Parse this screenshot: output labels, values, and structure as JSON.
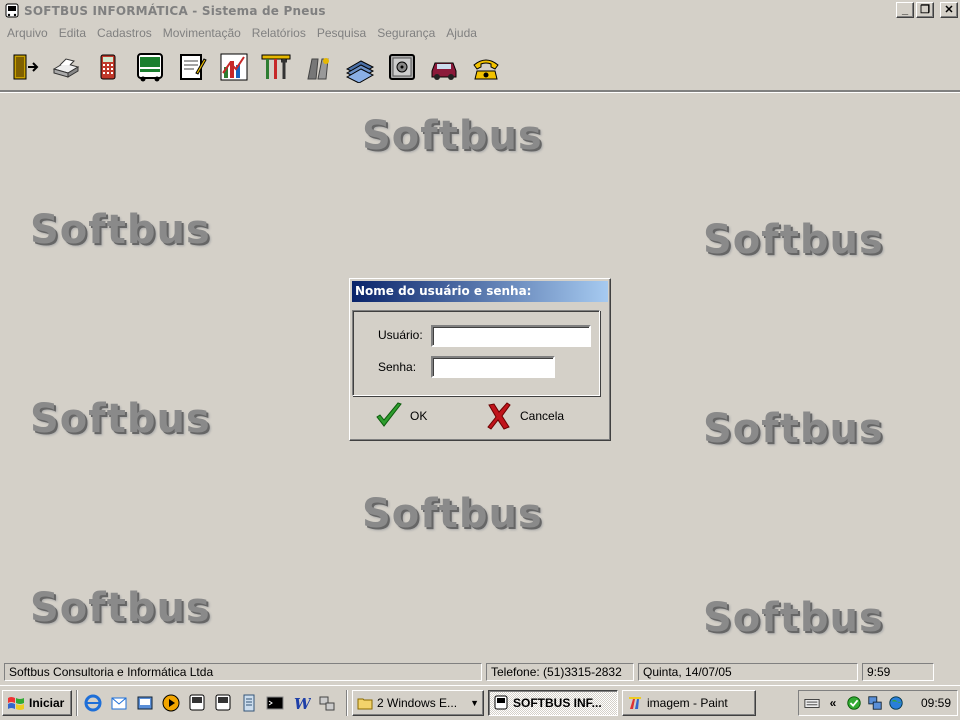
{
  "window": {
    "title": "SOFTBUS INFORMÁTICA - Sistema de Pneus",
    "minimize_glyph": "_",
    "restore_glyph": "❐",
    "close_glyph": "✕"
  },
  "menu": [
    {
      "label": "Arquivo"
    },
    {
      "label": "Edita"
    },
    {
      "label": "Cadastros"
    },
    {
      "label": "Movimentação"
    },
    {
      "label": "Relatórios"
    },
    {
      "label": "Pesquisa"
    },
    {
      "label": "Segurança"
    },
    {
      "label": "Ajuda"
    }
  ],
  "toolbar": {
    "icons": [
      "exit-door-icon",
      "printer-icon",
      "calculator-icon",
      "bus-icon",
      "notepad-icon",
      "chart-icon",
      "tools-icon",
      "tire-icon",
      "money-stack-icon",
      "safe-icon",
      "car-icon",
      "telephone-icon"
    ]
  },
  "watermark": {
    "text": "Softbus"
  },
  "dialog": {
    "title": "Nome do usuário e senha:",
    "user_label": "Usuário:",
    "user_value": "",
    "password_label": "Senha:",
    "password_value": "",
    "ok_label": "OK",
    "cancel_label": "Cancela"
  },
  "statusbar": {
    "company": "Softbus Consultoria e Informática Ltda",
    "phone": "Telefone: (51)3315-2832",
    "date": "Quinta, 14/07/05",
    "time": "9:59"
  },
  "taskbar": {
    "start_label": "Iniciar",
    "tasks": [
      {
        "label": "2 Windows E...",
        "icon": "folder-icon",
        "active": false
      },
      {
        "label": "SOFTBUS INF...",
        "icon": "bus-icon",
        "active": true
      },
      {
        "label": "imagem - Paint",
        "icon": "paint-icon",
        "active": false
      }
    ],
    "tray_chevron": "«",
    "clock": "09:59"
  },
  "colors": {
    "titlebar_gradient_start": "#0a246a",
    "titlebar_gradient_end": "#a6caf0",
    "face": "#d4d0c8"
  }
}
